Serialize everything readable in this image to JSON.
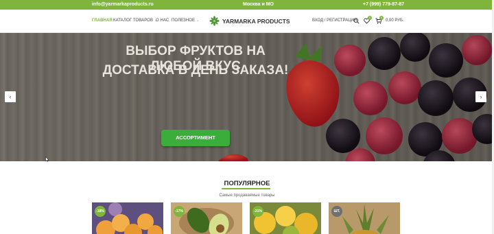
{
  "topbar": {
    "email": "info@yarmarkaproducts.ru",
    "region": "Москва и МО",
    "phone": "+7 (999) 779-87-87"
  },
  "nav": {
    "items": [
      {
        "label": "ГЛАВНАЯ",
        "active": true
      },
      {
        "label": "КАТАЛОГ ТОВАРОВ"
      },
      {
        "label": "О НАС"
      },
      {
        "label": "ПОЛЕЗНОЕ"
      }
    ],
    "logo_text": "YARMARKA PRODUCTS",
    "login": "ВХОД / РЕГИСТРАЦИЯ",
    "wishlist_count": "0",
    "cart_count": "0",
    "cart_total": "0,00 РУБ."
  },
  "hero": {
    "title_line1": "ВЫБОР ФРУКТОВ НА",
    "title_line2": "ЛЮБОЙ ВКУС",
    "subtitle": "ДОСТАВКА В ДЕНЬ ЗАКАЗА!",
    "button_label": "АССОРТИМЕНТ",
    "prev_arrow": "‹",
    "next_arrow": "›"
  },
  "popular": {
    "title": "ПОПУЛЯРНОЕ",
    "subtitle": "Самые продаваемые товары",
    "products": [
      {
        "badge": "-18%",
        "badge_color": "#80b53c"
      },
      {
        "badge": "-17%",
        "badge_color": "#80b53c"
      },
      {
        "badge": "-21%",
        "badge_color": "#80b53c"
      },
      {
        "badge": "ШТ.",
        "badge_color": "#6f6f6f"
      }
    ]
  },
  "colors": {
    "accent": "#80b53c",
    "cta": "#3aad3a"
  }
}
